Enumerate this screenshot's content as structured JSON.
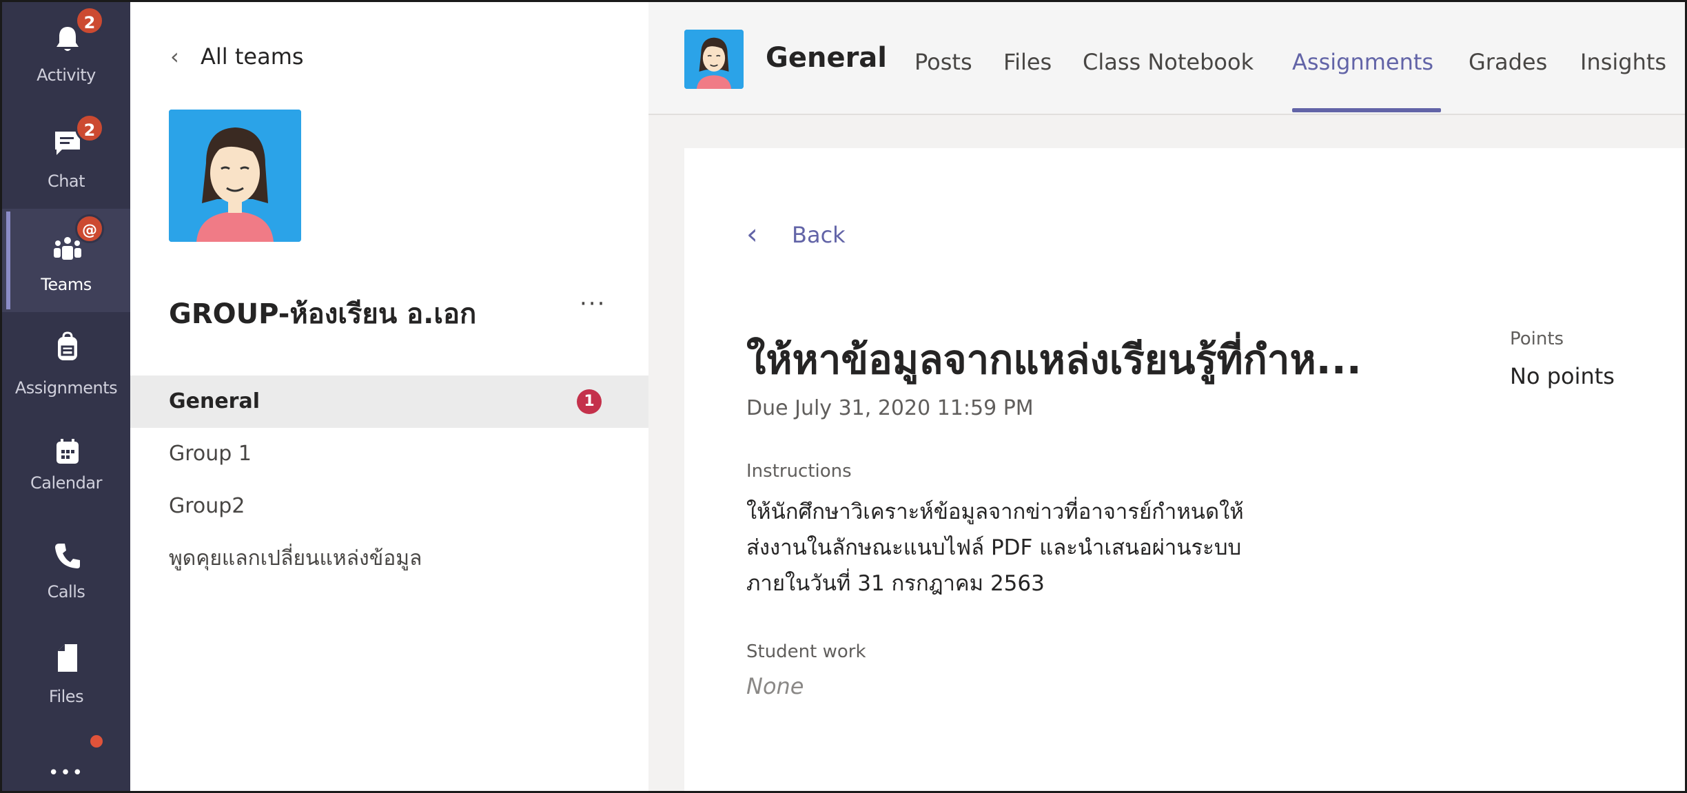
{
  "rail": {
    "activity_label": "Activity",
    "activity_badge": "2",
    "chat_label": "Chat",
    "chat_badge": "2",
    "teams_label": "Teams",
    "teams_badge": "@",
    "assignments_label": "Assignments",
    "calendar_label": "Calendar",
    "calls_label": "Calls",
    "files_label": "Files",
    "more_label": "•••"
  },
  "team_panel": {
    "all_teams_label": "All teams",
    "team_name": "GROUP-ห้องเรียน อ.เอก",
    "more_label": "···",
    "channels": [
      {
        "label": "General",
        "badge": "1"
      },
      {
        "label": "Group 1"
      },
      {
        "label": "Group2"
      },
      {
        "label": "พูดคุยแลกเปลี่ยนแหล่งข้อมูล"
      }
    ]
  },
  "header": {
    "channel_title": "General",
    "tabs": [
      "Posts",
      "Files",
      "Class Notebook",
      "Assignments",
      "Grades",
      "Insights"
    ],
    "active_tab": "Assignments"
  },
  "assignment": {
    "back_label": "Back",
    "title": "ให้หาข้อมูลจากแหล่งเรียนรู้ที่กำห...",
    "due": "Due July 31, 2020 11:59 PM",
    "points_label": "Points",
    "points_value": "No points",
    "instructions_label": "Instructions",
    "instructions_text": "ให้นักศึกษาวิเคราะห์ข้อมูลจากข่าวที่อาจารย์กำหนดให้ ส่งงานในลักษณะแนบไฟล์ PDF และนำเสนอผ่านระบบภายในวันที่ 31 กรกฎาคม 2563",
    "student_work_label": "Student work",
    "student_work_value": "None"
  },
  "colors": {
    "rail_bg": "#33344a",
    "accent": "#6264a7",
    "badge": "#cc4a31"
  }
}
